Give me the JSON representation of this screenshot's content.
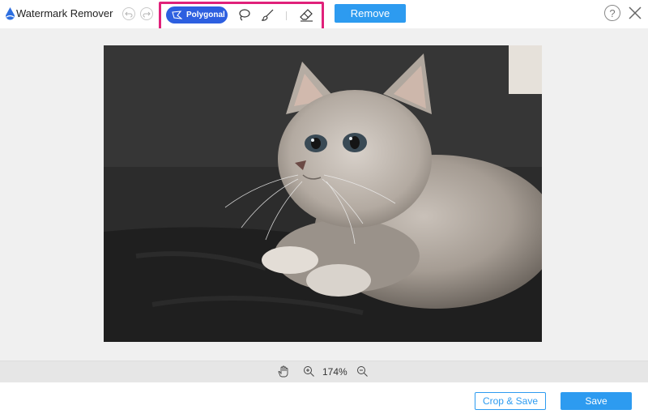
{
  "app": {
    "title": "Watermark Remover"
  },
  "toolbar": {
    "polygonal_label": "Polygonal",
    "remove_label": "Remove",
    "help_label": "?"
  },
  "zoom": {
    "value": "174%"
  },
  "footer": {
    "crop_save_label": "Crop & Save",
    "save_label": "Save"
  },
  "colors": {
    "accent": "#2d9bf0",
    "active_tool": "#2d5fe0",
    "highlight_border": "#e0217a",
    "canvas_bg": "#f0f0f0"
  },
  "icons": {
    "logo": "water-drop-logo-icon",
    "undo": "undo-icon",
    "redo": "redo-icon",
    "polygonal": "polygonal-lasso-icon",
    "lasso": "lasso-icon",
    "brush": "brush-icon",
    "eraser": "eraser-icon",
    "help": "help-icon",
    "close": "close-icon",
    "hand": "hand-pan-icon",
    "zoom_in": "zoom-in-icon",
    "zoom_out": "zoom-out-icon"
  }
}
